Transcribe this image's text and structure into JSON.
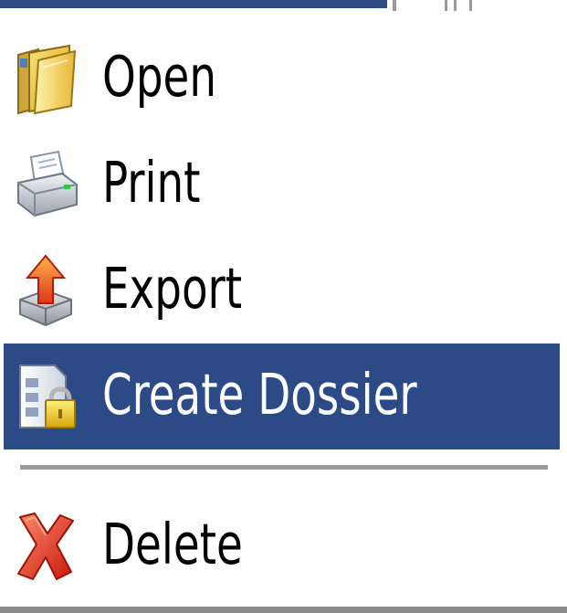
{
  "menu": {
    "items": [
      {
        "label": "Open",
        "icon": "folder-open-icon"
      },
      {
        "label": "Print",
        "icon": "printer-icon"
      },
      {
        "label": "Export",
        "icon": "export-icon"
      },
      {
        "label": "Create Dossier",
        "icon": "dossier-lock-icon",
        "selected": true
      },
      {
        "label": "Delete",
        "icon": "delete-x-icon"
      }
    ]
  },
  "colors": {
    "selection": "#2c4a86",
    "separator": "#9c9c9c",
    "text": "#000000",
    "selected_text": "#ffffff"
  }
}
